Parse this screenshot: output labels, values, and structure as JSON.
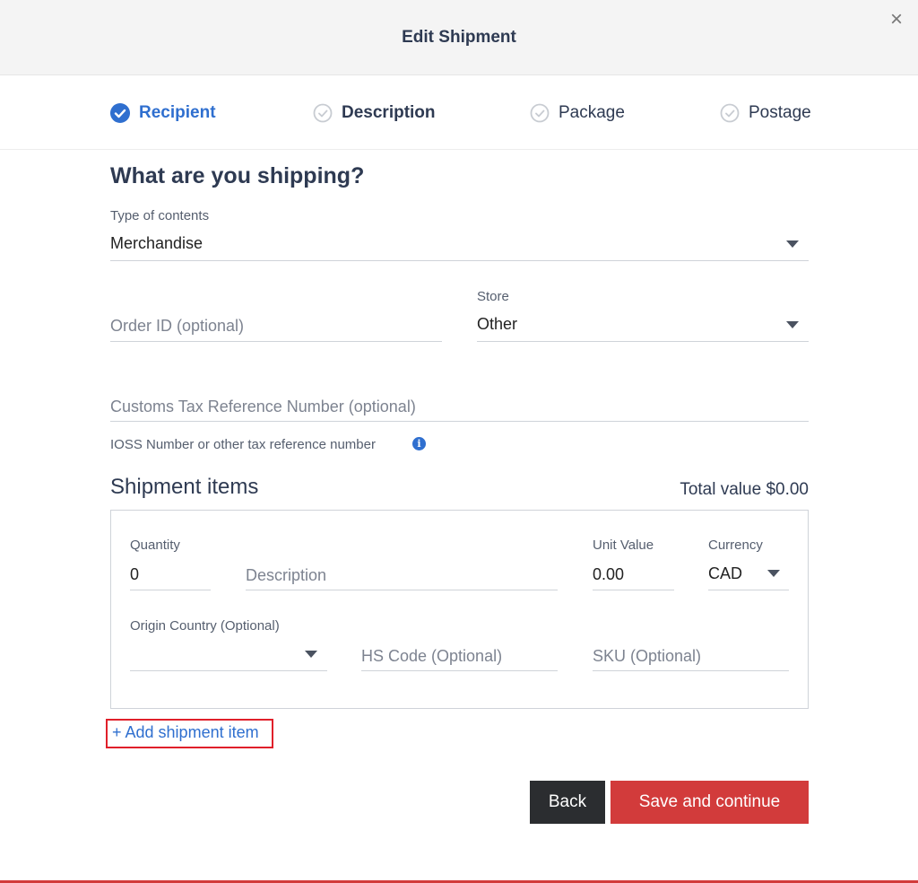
{
  "modal": {
    "title": "Edit Shipment",
    "close_glyph": "×"
  },
  "steps": [
    {
      "label": "Recipient",
      "state": "completed-active",
      "icon": "check-circle-icon"
    },
    {
      "label": "Description",
      "state": "current",
      "icon": "check-circle-outline-icon"
    },
    {
      "label": "Package",
      "state": "pending",
      "icon": "check-circle-outline-icon"
    },
    {
      "label": "Postage",
      "state": "pending",
      "icon": "check-circle-outline-icon"
    }
  ],
  "form": {
    "heading": "What are you shipping?",
    "type_of_contents": {
      "label": "Type of contents",
      "value": "Merchandise"
    },
    "order_id": {
      "placeholder": "Order ID (optional)"
    },
    "store": {
      "label": "Store",
      "value": "Other"
    },
    "customs_tax": {
      "placeholder": "Customs Tax Reference Number (optional)"
    },
    "ioss_hint": "IOSS Number or other tax reference number",
    "info_glyph": "i"
  },
  "items": {
    "heading": "Shipment items",
    "total": "Total value $0.00",
    "quantity": {
      "label": "Quantity",
      "value": "0"
    },
    "description": {
      "placeholder": "Description"
    },
    "unit_value": {
      "label": "Unit Value",
      "value": "0.00"
    },
    "currency": {
      "label": "Currency",
      "value": "CAD"
    },
    "origin_country": {
      "label": "Origin Country (Optional)",
      "value": ""
    },
    "hs_code": {
      "placeholder": "HS Code (Optional)"
    },
    "sku": {
      "placeholder": "SKU (Optional)"
    },
    "add_link": "+ Add shipment item"
  },
  "actions": {
    "back": "Back",
    "save": "Save and continue"
  },
  "colors": {
    "accent_blue": "#2f6fcf",
    "primary_red": "#d23b3b",
    "dark_button": "#2b2d30",
    "text_navy": "#2e3a52"
  }
}
